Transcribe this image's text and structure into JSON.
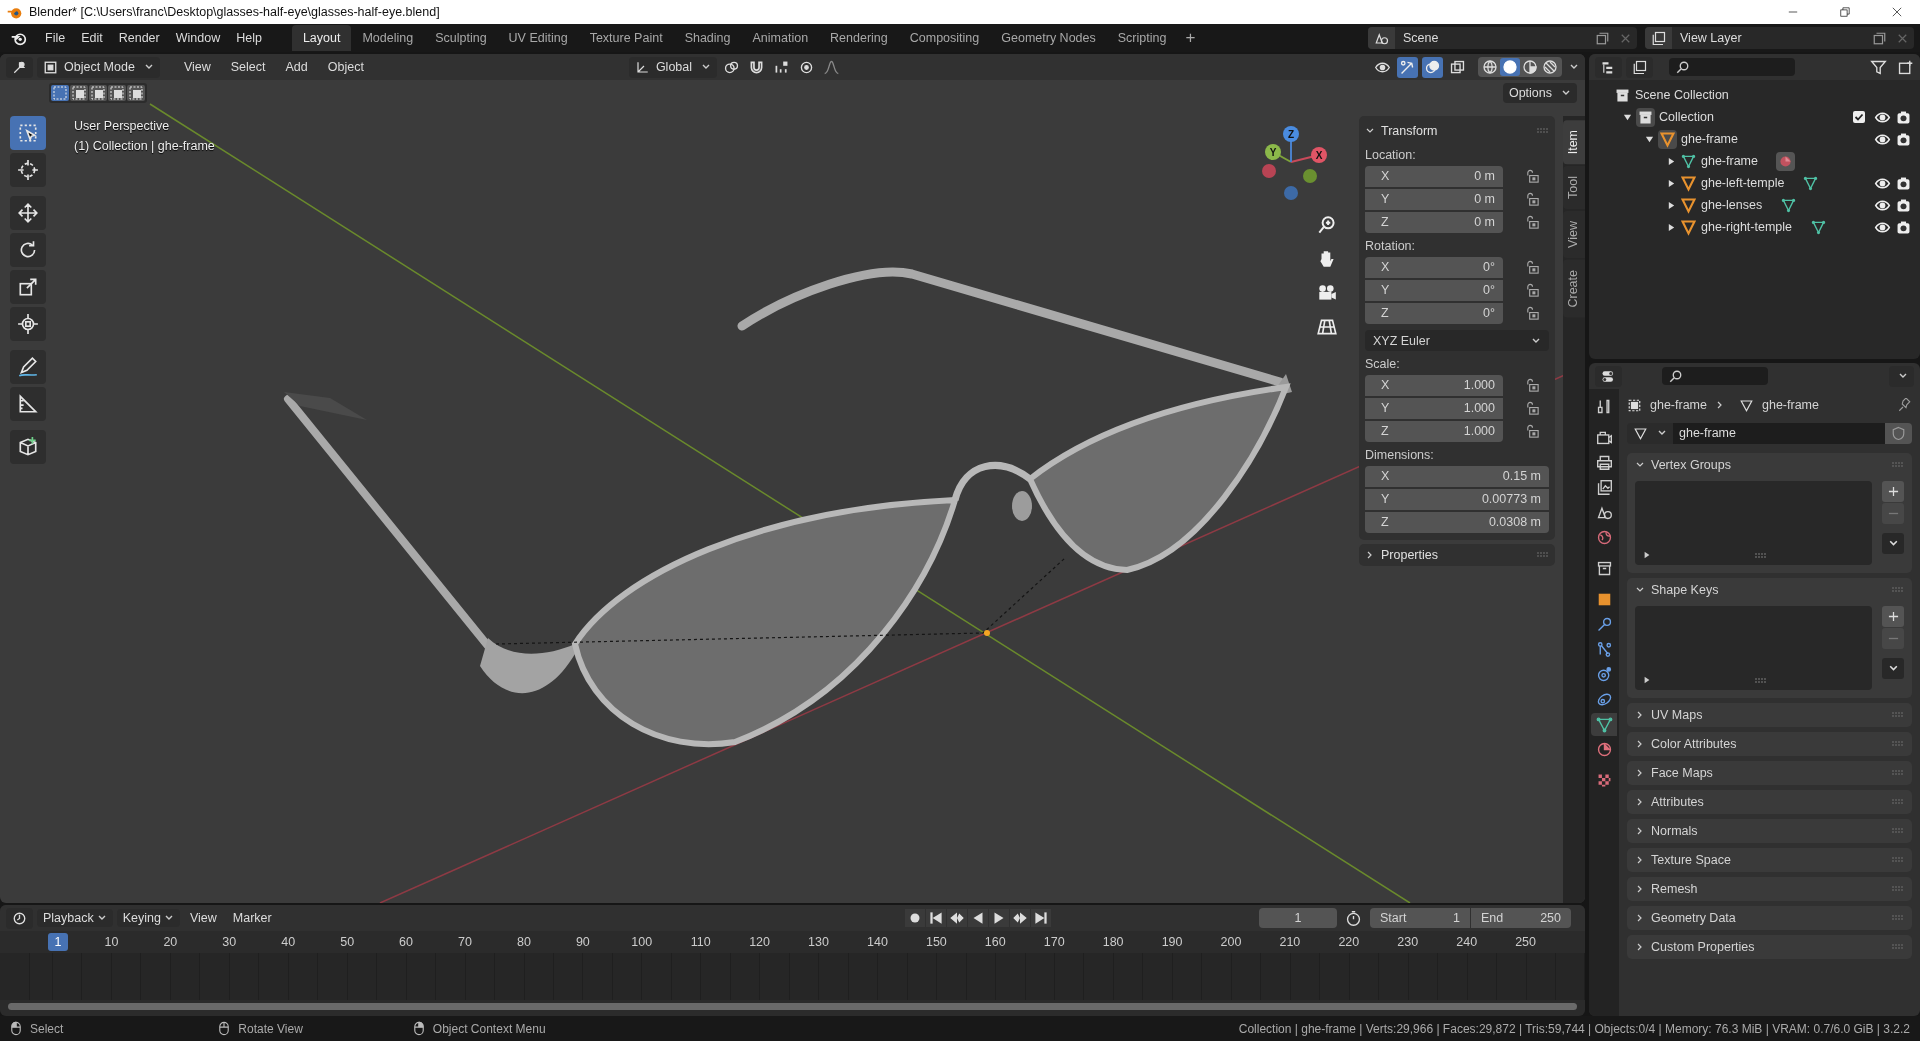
{
  "window": {
    "title": "Blender* [C:\\Users\\franc\\Desktop\\glasses-half-eye\\glasses-half-eye.blend]"
  },
  "menu": [
    "File",
    "Edit",
    "Render",
    "Window",
    "Help"
  ],
  "workspaces": [
    {
      "label": "Layout",
      "selected": true
    },
    {
      "label": "Modeling",
      "selected": false
    },
    {
      "label": "Sculpting",
      "selected": false
    },
    {
      "label": "UV Editing",
      "selected": false
    },
    {
      "label": "Texture Paint",
      "selected": false
    },
    {
      "label": "Shading",
      "selected": false
    },
    {
      "label": "Animation",
      "selected": false
    },
    {
      "label": "Rendering",
      "selected": false
    },
    {
      "label": "Compositing",
      "selected": false
    },
    {
      "label": "Geometry Nodes",
      "selected": false
    },
    {
      "label": "Scripting",
      "selected": false
    }
  ],
  "add_workspace": "+",
  "scene": "Scene",
  "view_layer": "View Layer",
  "viewport": {
    "mode": "Object Mode",
    "menus": [
      "View",
      "Select",
      "Add",
      "Object"
    ],
    "orientation": "Global",
    "options": "Options",
    "info": [
      "User Perspective",
      "(1) Collection | ghe-frame"
    ],
    "gizmo_labels": [
      "Z",
      "Y",
      "X"
    ],
    "gizmos_on": true,
    "overlays_on": true,
    "shading": [
      {
        "kind": "wireframe",
        "selected": false
      },
      {
        "kind": "solid",
        "selected": true
      },
      {
        "kind": "material",
        "selected": false
      },
      {
        "kind": "rendered",
        "selected": false
      }
    ]
  },
  "select_modes": [
    {
      "selected": true
    },
    {
      "selected": false
    },
    {
      "selected": false
    },
    {
      "selected": false
    },
    {
      "selected": false
    }
  ],
  "tools": [
    {
      "kind": "select",
      "selected": true
    },
    {
      "kind": "cursor",
      "selected": false
    },
    {
      "kind": "move",
      "selected": false
    },
    {
      "kind": "rotate",
      "selected": false
    },
    {
      "kind": "scale",
      "selected": false
    },
    {
      "kind": "transform",
      "selected": false
    },
    {
      "kind": "annotate",
      "selected": false
    },
    {
      "kind": "measure",
      "selected": false
    },
    {
      "kind": "add_cube",
      "selected": false
    }
  ],
  "sidebar": {
    "tabs": [
      {
        "label": "Item",
        "selected": true
      },
      {
        "label": "Tool",
        "selected": false
      },
      {
        "label": "View",
        "selected": false
      },
      {
        "label": "Create",
        "selected": false
      }
    ],
    "title": "Transform",
    "groups": [
      {
        "kind": "lockable",
        "label": "Location:",
        "fields": [
          {
            "axis": "X",
            "value": "0 m"
          },
          {
            "axis": "Y",
            "value": "0 m"
          },
          {
            "axis": "Z",
            "value": "0 m"
          }
        ]
      },
      {
        "kind": "lockable",
        "label": "Rotation:",
        "fields": [
          {
            "axis": "X",
            "value": "0°"
          },
          {
            "axis": "Y",
            "value": "0°"
          },
          {
            "axis": "Z",
            "value": "0°"
          }
        ]
      },
      {
        "kind": "dropdown",
        "value": "XYZ Euler"
      },
      {
        "kind": "lockable",
        "label": "Scale:",
        "fields": [
          {
            "axis": "X",
            "value": "1.000"
          },
          {
            "axis": "Y",
            "value": "1.000"
          },
          {
            "axis": "Z",
            "value": "1.000"
          }
        ]
      },
      {
        "kind": "plain",
        "label": "Dimensions:",
        "fields": [
          {
            "axis": "X",
            "value": "0.15 m"
          },
          {
            "axis": "Y",
            "value": "0.00773 m"
          },
          {
            "axis": "Z",
            "value": "0.0308 m"
          }
        ]
      }
    ],
    "footer_panel": "Properties"
  },
  "outliner": {
    "tree": [
      {
        "kind": "scene_collection",
        "label": "Scene Collection",
        "children": [
          {
            "kind": "collection",
            "label": "Collection",
            "expanded": true,
            "checked": true,
            "children": [
              {
                "kind": "object",
                "label": "ghe-frame",
                "expanded": true,
                "children": [
                  {
                    "kind": "mesh",
                    "label": "ghe-frame",
                    "expanded": false
                  },
                  {
                    "kind": "object",
                    "label": "ghe-left-temple",
                    "expanded": false
                  },
                  {
                    "kind": "object",
                    "label": "ghe-lenses",
                    "expanded": false
                  },
                  {
                    "kind": "object",
                    "label": "ghe-right-temple",
                    "expanded": false
                  }
                ]
              }
            ]
          }
        ]
      }
    ]
  },
  "properties": {
    "tabs": [
      {
        "kind": "tool",
        "selected": false
      },
      {
        "kind": "render",
        "selected": false
      },
      {
        "kind": "output",
        "selected": false
      },
      {
        "kind": "view_layer",
        "selected": false
      },
      {
        "kind": "scene",
        "selected": false
      },
      {
        "kind": "world",
        "selected": false
      },
      {
        "kind": "collection",
        "selected": false
      },
      {
        "kind": "object",
        "selected": false
      },
      {
        "kind": "modifiers",
        "selected": false
      },
      {
        "kind": "particles",
        "selected": false
      },
      {
        "kind": "physics",
        "selected": false
      },
      {
        "kind": "constraints",
        "selected": false
      },
      {
        "kind": "data",
        "selected": true
      },
      {
        "kind": "material",
        "selected": false
      },
      {
        "kind": "texture",
        "selected": false
      }
    ],
    "breadcrumb": [
      "ghe-frame",
      "ghe-frame"
    ],
    "data_name": "ghe-frame",
    "panels": [
      {
        "label": "Vertex Groups",
        "expanded": true
      },
      {
        "label": "Shape Keys",
        "expanded": true
      },
      {
        "label": "UV Maps",
        "expanded": false
      },
      {
        "label": "Color Attributes",
        "expanded": false
      },
      {
        "label": "Face Maps",
        "expanded": false
      },
      {
        "label": "Attributes",
        "expanded": false
      },
      {
        "label": "Normals",
        "expanded": false
      },
      {
        "label": "Texture Space",
        "expanded": false
      },
      {
        "label": "Remesh",
        "expanded": false
      },
      {
        "label": "Geometry Data",
        "expanded": false
      },
      {
        "label": "Custom Properties",
        "expanded": false
      }
    ]
  },
  "timeline": {
    "menus": [
      "Playback",
      "Keying",
      "View",
      "Marker"
    ],
    "current_frame": "1",
    "start_label": "Start",
    "start": "1",
    "end_label": "End",
    "end": "250",
    "playhead": "1",
    "ticks": [
      "10",
      "20",
      "30",
      "40",
      "50",
      "60",
      "70",
      "80",
      "90",
      "100",
      "110",
      "120",
      "130",
      "140",
      "150",
      "160",
      "170",
      "180",
      "190",
      "200",
      "210",
      "220",
      "230",
      "240",
      "250"
    ]
  },
  "status_bar": {
    "hints": [
      "Select",
      "Rotate View",
      "Object Context Menu"
    ],
    "stats": "Collection | ghe-frame | Verts:29,966 | Faces:29,872 | Tris:59,744 | Objects:0/4 | Memory: 76.3 MiB | VRAM: 0.7/6.0 GiB | 3.2.2"
  }
}
